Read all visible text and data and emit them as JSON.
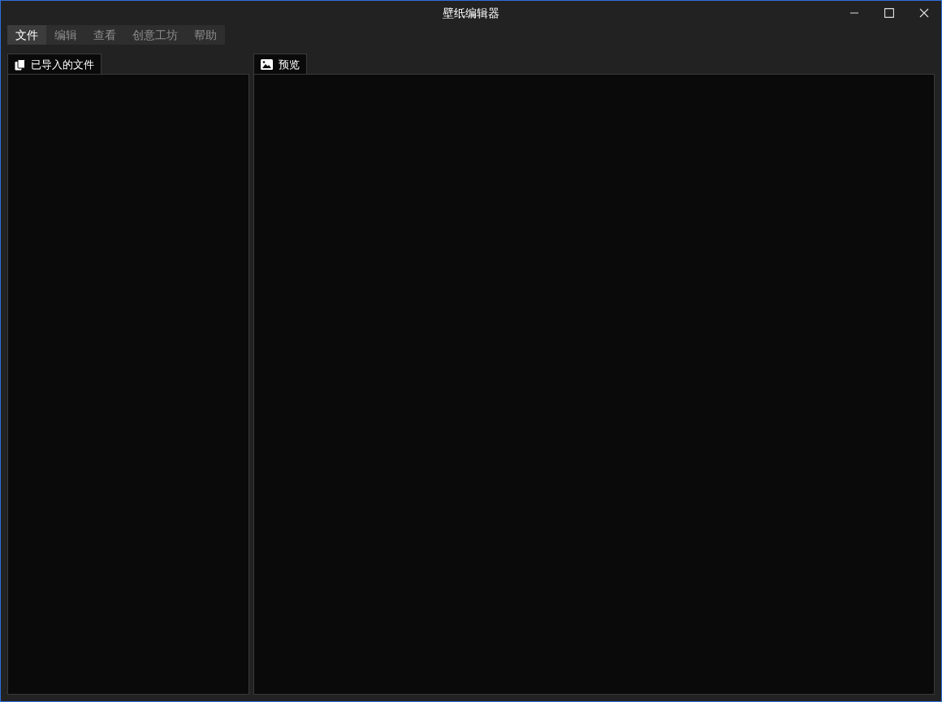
{
  "window": {
    "title": "壁纸编辑器"
  },
  "menu": [
    {
      "label": "文件",
      "selected": true
    },
    {
      "label": "编辑",
      "selected": false
    },
    {
      "label": "查看",
      "selected": false
    },
    {
      "label": "创意工坊",
      "selected": false
    },
    {
      "label": "帮助",
      "selected": false
    }
  ],
  "panels": [
    {
      "kind": "files",
      "tab": "已导入的文件"
    },
    {
      "kind": "preview",
      "tab": "预览"
    }
  ]
}
